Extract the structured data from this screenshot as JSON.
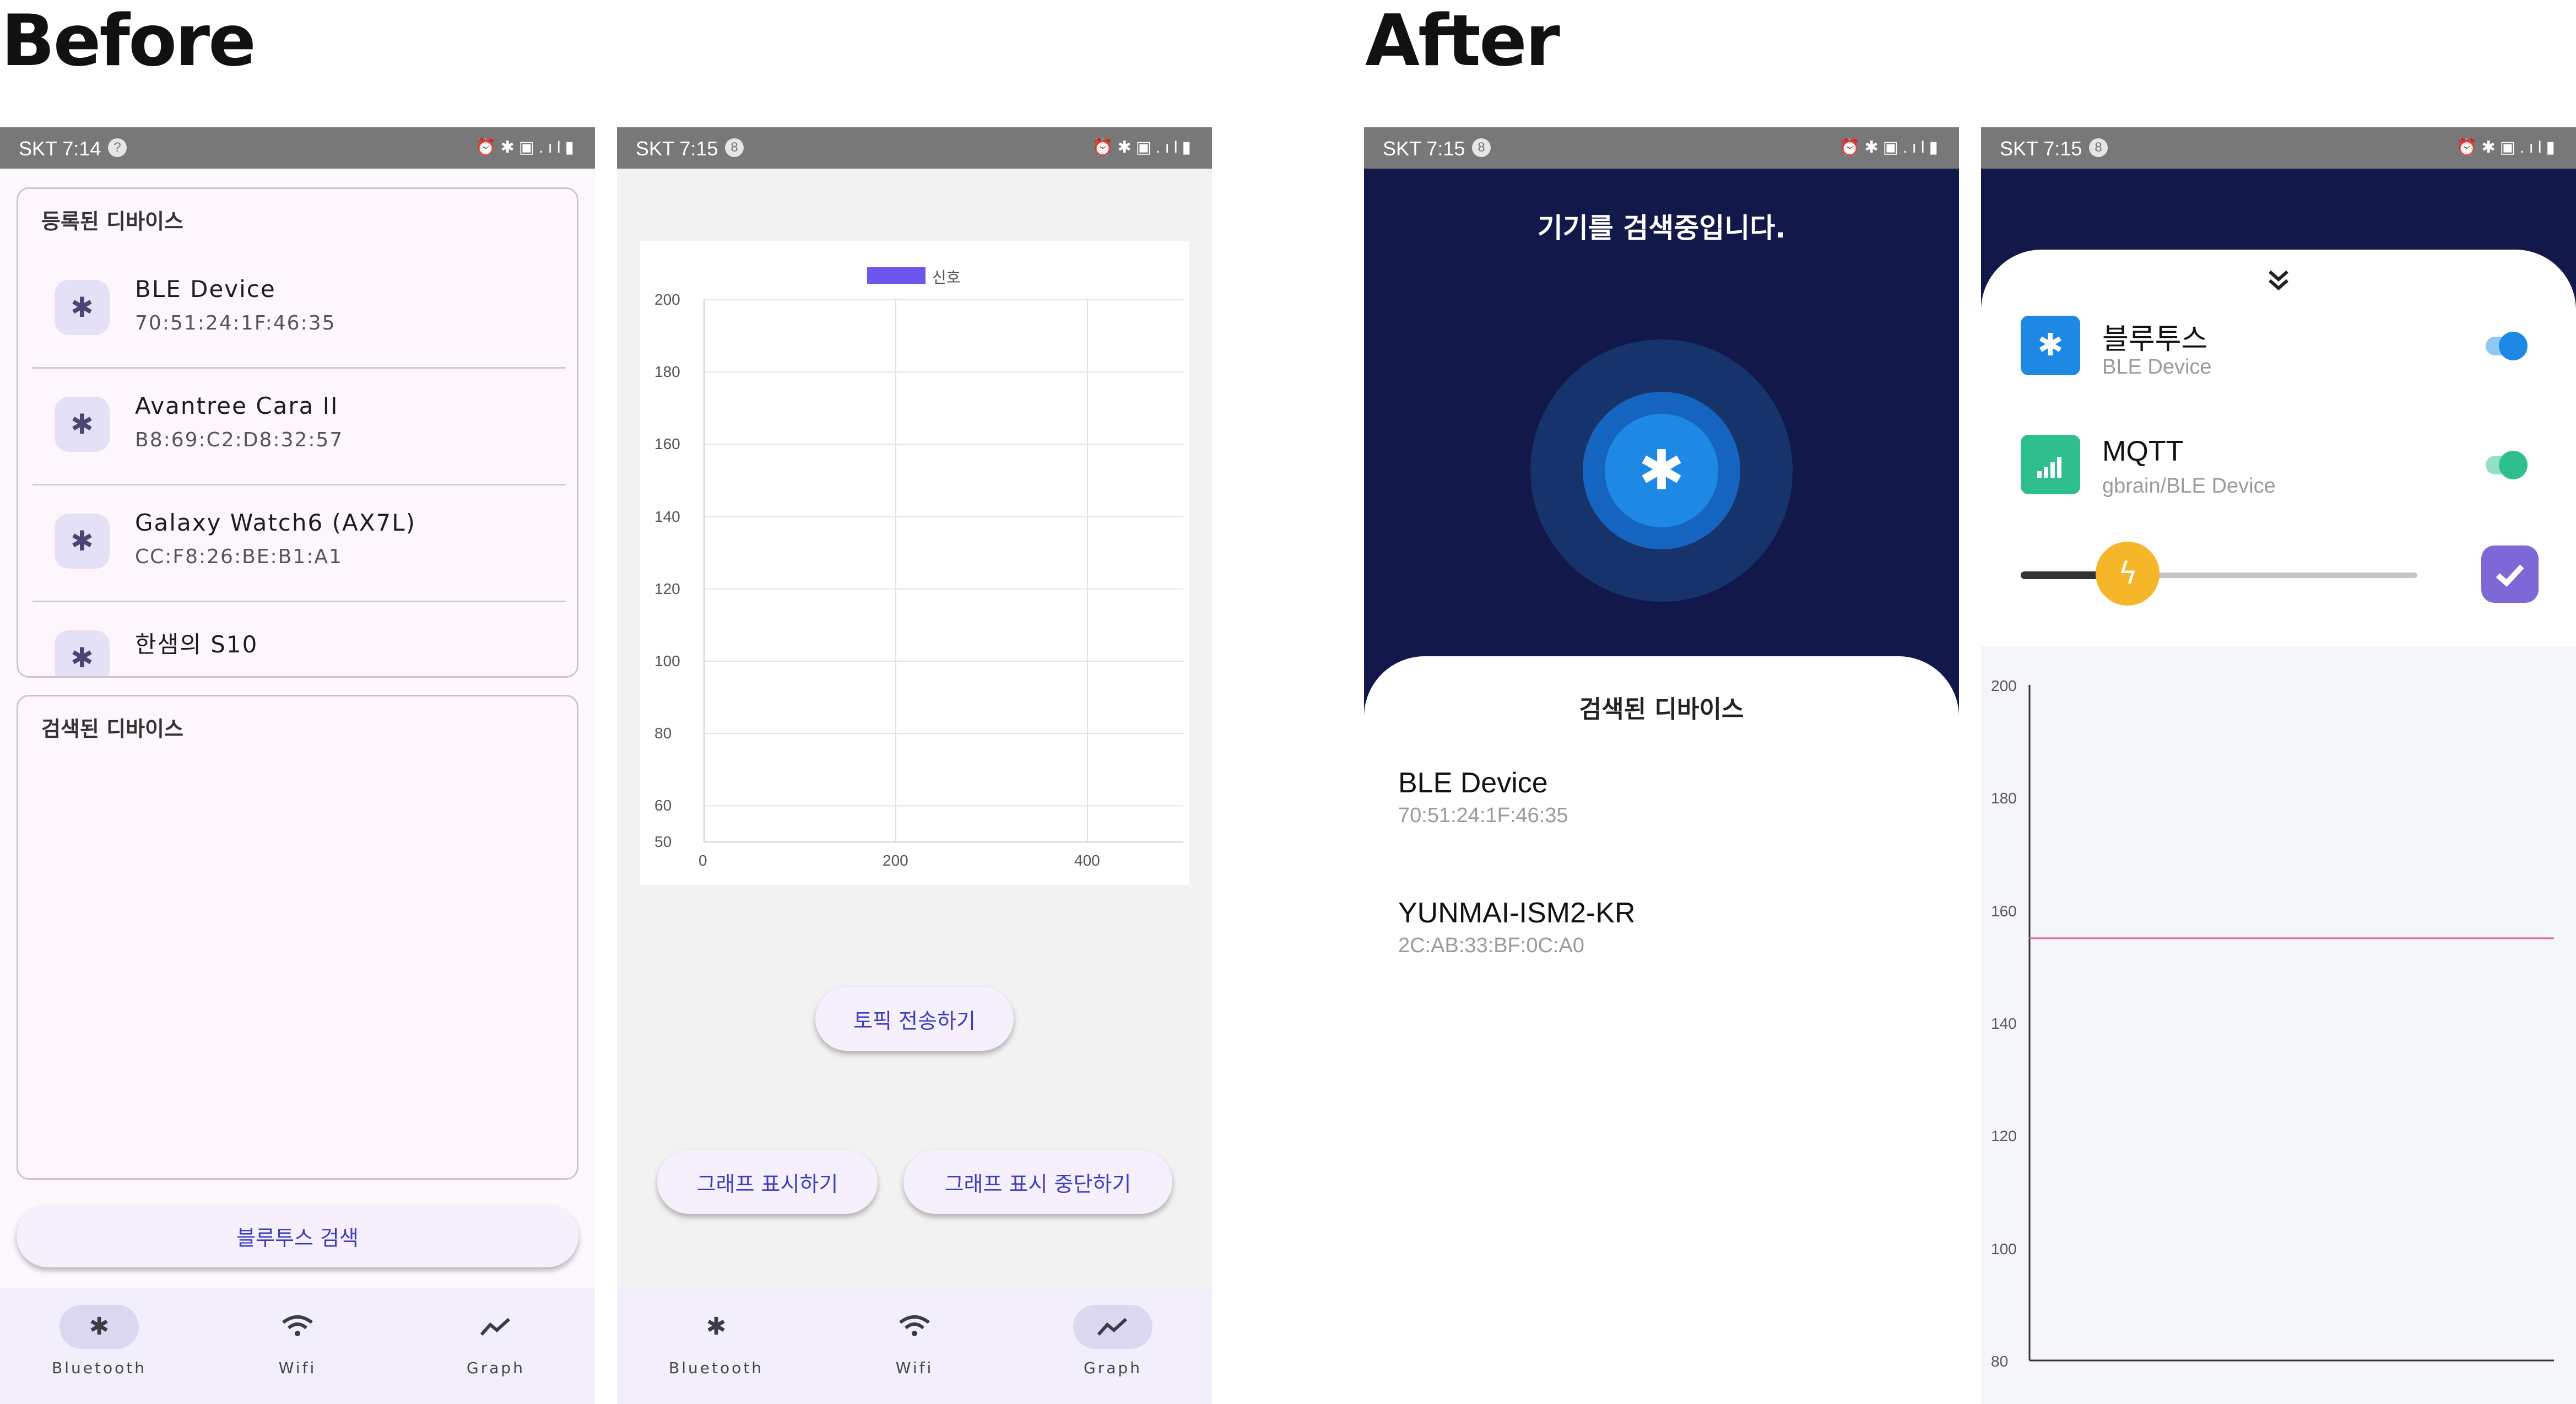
{
  "headings": {
    "before": "Before",
    "after": "After"
  },
  "status": {
    "s1_time": "SKT 7:14",
    "s1_badge": "?",
    "s2_time": "SKT 7:15",
    "s2_badge": "8",
    "s3_time": "SKT 7:15",
    "s3_badge": "8",
    "s4_time": "SKT 7:15",
    "s4_badge": "8",
    "icons": "⏰✱▣.ıl▮"
  },
  "screen1": {
    "registered_title": "등록된 디바이스",
    "registered": [
      {
        "name": "BLE Device",
        "mac": "70:51:24:1F:46:35"
      },
      {
        "name": "Avantree Cara II",
        "mac": "B8:69:C2:D8:32:57"
      },
      {
        "name": "Galaxy Watch6 (AX7L)",
        "mac": "CC:F8:26:BE:B1:A1"
      },
      {
        "name": "한샘의 S10",
        "mac": ""
      }
    ],
    "searched_title": "검색된 디바이스",
    "search_button": "블루투스 검색"
  },
  "nav": {
    "bluetooth": "Bluetooth",
    "wifi": "Wifi",
    "graph": "Graph"
  },
  "screen2": {
    "legend": "신호",
    "y_ticks": [
      "200",
      "180",
      "160",
      "140",
      "120",
      "100",
      "80",
      "60",
      "50"
    ],
    "x_ticks": [
      "0",
      "200",
      "400"
    ],
    "topic_button": "토픽 전송하기",
    "show_graph_button": "그래프 표시하기",
    "stop_graph_button": "그래프 표시 중단하기"
  },
  "screen3": {
    "searching_title": "기기를 검색중입니다.",
    "found_title": "검색된 디바이스",
    "found": [
      {
        "name": "BLE Device",
        "mac": "70:51:24:1F:46:35"
      },
      {
        "name": "YUNMAI-ISM2-KR",
        "mac": "2C:AB:33:BF:0C:A0"
      }
    ]
  },
  "screen4": {
    "bt_title": "블루투스",
    "bt_sub": "BLE Device",
    "mqtt_title": "MQTT",
    "mqtt_sub": "gbrain/BLE Device",
    "y_ticks": [
      "200",
      "180",
      "160",
      "140",
      "120",
      "100",
      "80"
    ]
  },
  "colors": {
    "accent_blue": "#1e88e5",
    "mqtt_green": "#2fbf8f",
    "slider_orange": "#f6b62a",
    "check_purple": "#7e67d7",
    "navy": "#12194a",
    "chart_line": "#e06b8c",
    "legend_fill": "#6b57f0"
  },
  "controls": {
    "bt_on": true,
    "mqtt_on": true,
    "slider_level": 0.27
  },
  "chart_data": [
    {
      "type": "line",
      "series": [
        {
          "name": "신호",
          "values": []
        }
      ],
      "ylim": [
        50,
        200
      ],
      "xlim": [
        0,
        500
      ],
      "grid": true,
      "legend": "top-center"
    },
    {
      "type": "line",
      "series": [
        {
          "values": [
            155,
            155
          ]
        }
      ],
      "x": [
        0,
        1
      ],
      "ylim": [
        80,
        200
      ],
      "grid": false
    }
  ]
}
